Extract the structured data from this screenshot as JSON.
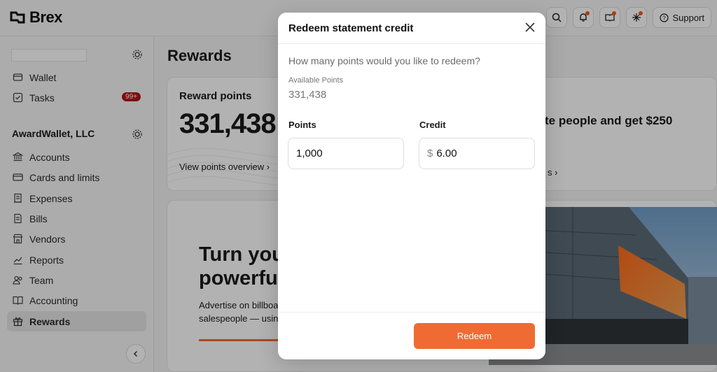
{
  "app": {
    "brand": "Brex"
  },
  "topbar": {
    "buttons": [
      {
        "icon": "search-icon"
      },
      {
        "icon": "bell-icon",
        "dot": true
      },
      {
        "icon": "book-icon",
        "dot": true
      },
      {
        "icon": "sparkle-icon",
        "dot": true
      }
    ],
    "support_label": "Support"
  },
  "sidebar": {
    "items_top": [
      {
        "label": "Wallet",
        "icon": "wallet-icon"
      },
      {
        "label": "Tasks",
        "icon": "checkbox-icon",
        "badge": "99+"
      }
    ],
    "company": "AwardWallet, LLC",
    "items": [
      {
        "label": "Accounts",
        "icon": "bank-icon"
      },
      {
        "label": "Cards and limits",
        "icon": "card-icon"
      },
      {
        "label": "Expenses",
        "icon": "receipt-icon"
      },
      {
        "label": "Bills",
        "icon": "document-icon"
      },
      {
        "label": "Vendors",
        "icon": "store-icon"
      },
      {
        "label": "Reports",
        "icon": "chart-icon"
      },
      {
        "label": "Team",
        "icon": "people-icon"
      },
      {
        "label": "Accounting",
        "icon": "book-icon"
      },
      {
        "label": "Rewards",
        "icon": "gift-icon",
        "active": true
      }
    ]
  },
  "main": {
    "title": "Rewards",
    "reward_card": {
      "label": "Reward points",
      "value": "331,438",
      "link": "View points overview"
    },
    "refer_card": {
      "text": "te people and get $250",
      "link": "s"
    },
    "promo": {
      "title_line1": "Turn you",
      "title_line2": "powerful",
      "body_line1": "Advertise on billboa",
      "body_line2": "salespeople — usin"
    }
  },
  "modal": {
    "title": "Redeem statement credit",
    "question": "How many points would you like to redeem?",
    "available_label": "Available Points",
    "available_value": "331,438",
    "points_label": "Points",
    "points_value": "1,000",
    "credit_label": "Credit",
    "currency_symbol": "$",
    "credit_value": "6.00",
    "redeem_label": "Redeem"
  },
  "colors": {
    "accent": "#f06a34",
    "badge": "#b3151b"
  }
}
